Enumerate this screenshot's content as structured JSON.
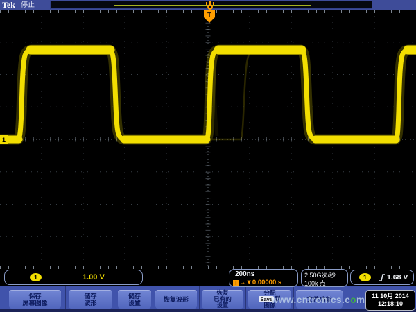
{
  "header": {
    "logo": "Tek",
    "status": "停止",
    "trigger_marker": "T"
  },
  "readouts": {
    "ch1": {
      "channel": "1",
      "scale": "1.00 V"
    },
    "horizontal": {
      "scale": "200ns",
      "trigger_symbol": "T",
      "arrows": "→▼",
      "position": "0.00000 s"
    },
    "acquisition": {
      "sample_rate": "2.50G次/秒",
      "record_length": "100k 点"
    },
    "trigger": {
      "channel": "1",
      "level": "1.68 V"
    }
  },
  "menu": {
    "buttons": [
      {
        "lines": [
          "保存",
          "屏幕图像"
        ]
      },
      {
        "lines": [
          "储存",
          "波形"
        ]
      },
      {
        "lines": [
          "储存",
          "设置"
        ]
      },
      {
        "lines": [
          "恢复波形"
        ]
      },
      {
        "lines": [
          "恢复",
          "已有的",
          "设置"
        ]
      },
      {
        "line1": "分配",
        "badge": "Save",
        "line2_suffix": "到",
        "line3": "图像"
      },
      {
        "lines": [
          "文件功能"
        ]
      }
    ]
  },
  "datetime": {
    "date": "11 10月 2014",
    "time": "12:18:10"
  },
  "watermark": {
    "text_left": "www.cntronics.c",
    "dot": "o",
    "text_right": "m"
  },
  "colors": {
    "ch1_yellow": "#f2de00",
    "trigger_orange": "#ff9d00",
    "top_bar_blue": "#3e4c99",
    "menu_blue": "#4053ab",
    "button_blue": "#5d74c9"
  },
  "chart_data": {
    "type": "line",
    "title": "",
    "series": [
      {
        "name": "CH1",
        "waveform": "square",
        "high_volts": 2.75,
        "low_volts": 0.0,
        "period_ns": 900,
        "duty_cycle": 0.5
      }
    ],
    "x_axis": {
      "scale_per_div": "200ns",
      "divisions": 10,
      "position_offset": "0.00000 s"
    },
    "y_axis": {
      "scale_per_div": "1.00 V",
      "divisions": 8
    },
    "trigger": {
      "source": "CH1",
      "level_volts": 1.68,
      "slope": "rising",
      "position": "center"
    },
    "acquisition": {
      "sample_rate": "2.50G次/秒",
      "record_length": "100k 点",
      "state": "停止"
    }
  }
}
